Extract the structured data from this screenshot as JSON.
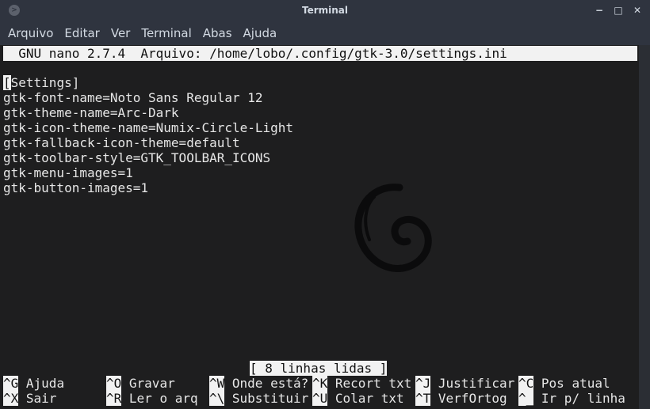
{
  "window": {
    "title": "Terminal",
    "controls": [
      "minimize",
      "maximize",
      "close"
    ]
  },
  "menu": [
    "Arquivo",
    "Editar",
    "Ver",
    "Terminal",
    "Abas",
    "Ajuda"
  ],
  "nano": {
    "header": "  GNU nano 2.7.4  Arquivo: /home/lobo/.config/gtk-3.0/settings.ini",
    "lines": [
      "[Settings]",
      "gtk-font-name=Noto Sans Regular 12",
      "gtk-theme-name=Arc-Dark",
      "gtk-icon-theme-name=Numix-Circle-Light",
      "gtk-fallback-icon-theme=default",
      "gtk-toolbar-style=GTK_TOOLBAR_ICONS",
      "gtk-menu-images=1",
      "gtk-button-images=1"
    ],
    "status": "[ 8 linhas lidas ]",
    "shortcuts": [
      [
        {
          "key": "^G",
          "label": "Ajuda"
        },
        {
          "key": "^O",
          "label": "Gravar"
        },
        {
          "key": "^W",
          "label": "Onde está?"
        },
        {
          "key": "^K",
          "label": "Recort txt"
        },
        {
          "key": "^J",
          "label": "Justificar"
        },
        {
          "key": "^C",
          "label": "Pos atual"
        }
      ],
      [
        {
          "key": "^X",
          "label": "Sair"
        },
        {
          "key": "^R",
          "label": "Ler o arq"
        },
        {
          "key": "^\\",
          "label": "Substituir"
        },
        {
          "key": "^U",
          "label": "Colar txt"
        },
        {
          "key": "^T",
          "label": "VerfOrtog"
        },
        {
          "key": "^_",
          "label": "Ir p/ linha"
        }
      ]
    ]
  },
  "icons": {
    "window_icon": "terminal-app-icon",
    "logo": "debian-swirl-logo"
  }
}
